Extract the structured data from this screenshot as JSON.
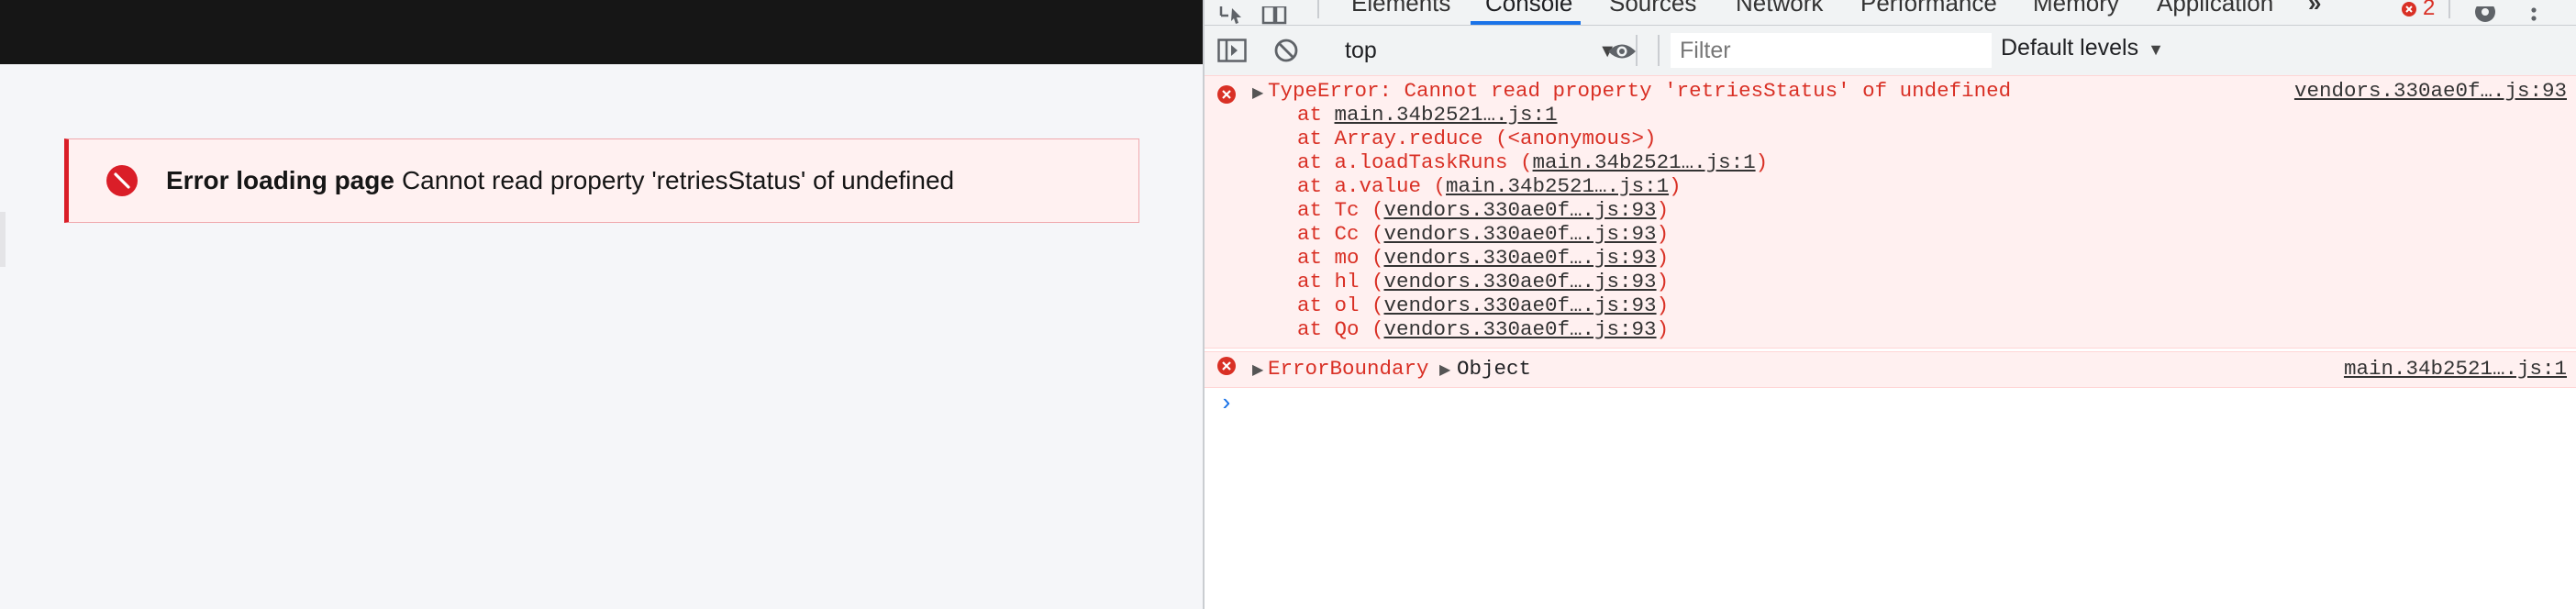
{
  "notification": {
    "title": "Error loading page",
    "message": "Cannot read property 'retriesStatus' of undefined"
  },
  "devtools": {
    "tabs": {
      "elements": "Elements",
      "console": "Console",
      "sources": "Sources",
      "network": "Network",
      "performance": "Performance",
      "memory": "Memory",
      "application": "Application"
    },
    "more_tabs": "»",
    "error_count": "2",
    "toolbar": {
      "context": "top",
      "filter_placeholder": "Filter",
      "levels": "Default levels"
    },
    "messages": [
      {
        "text": "TypeError: Cannot read property 'retriesStatus' of undefined",
        "source": "vendors.330ae0f….js:93",
        "stack": [
          {
            "prefix": "at ",
            "link": "main.34b2521….js:1",
            "suffix": ""
          },
          {
            "prefix": "at Array.reduce (<anonymous>)",
            "link": "",
            "suffix": ""
          },
          {
            "prefix": "at a.loadTaskRuns (",
            "link": "main.34b2521….js:1",
            "suffix": ")"
          },
          {
            "prefix": "at a.value (",
            "link": "main.34b2521….js:1",
            "suffix": ")"
          },
          {
            "prefix": "at Tc (",
            "link": "vendors.330ae0f….js:93",
            "suffix": ")"
          },
          {
            "prefix": "at Cc (",
            "link": "vendors.330ae0f….js:93",
            "suffix": ")"
          },
          {
            "prefix": "at mo (",
            "link": "vendors.330ae0f….js:93",
            "suffix": ")"
          },
          {
            "prefix": "at hl (",
            "link": "vendors.330ae0f….js:93",
            "suffix": ")"
          },
          {
            "prefix": "at ol (",
            "link": "vendors.330ae0f….js:93",
            "suffix": ")"
          },
          {
            "prefix": "at Qo (",
            "link": "vendors.330ae0f….js:93",
            "suffix": ")"
          }
        ]
      },
      {
        "text": "ErrorBoundary",
        "object_label": "Object",
        "source": "main.34b2521….js:1"
      }
    ],
    "prompt": "›"
  },
  "colors": {
    "error_red": "#da1e28",
    "console_error_text": "#d93025",
    "console_error_bg": "#fff0f0",
    "notification_bg": "#fff1f1",
    "app_topbar": "#161616",
    "devtools_accent": "#1a73e8"
  },
  "icons": {
    "notification": "error-filled-icon",
    "inspect": "inspect-element-icon",
    "device": "device-toolbar-icon",
    "settings": "gear-icon",
    "menu": "kebab-menu-icon",
    "sidebar": "sidebar-toggle-icon",
    "clear": "clear-console-icon",
    "live_expression": "eye-icon",
    "console_error": "error-circle-icon"
  }
}
